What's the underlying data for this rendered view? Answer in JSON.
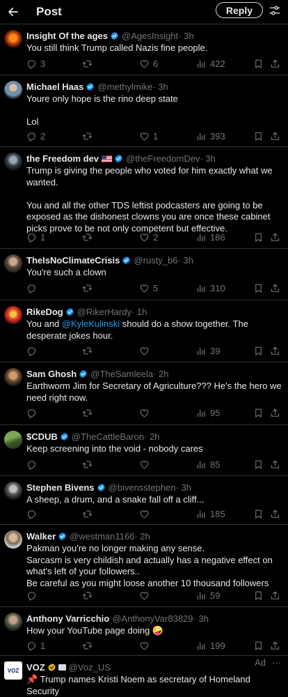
{
  "header": {
    "title": "Post",
    "reply_button": "Reply"
  },
  "colors": {
    "background": "#000000",
    "text": "#e7e9ea",
    "muted": "#71767b",
    "divider": "#2f3336",
    "verified": "#1d9bf0",
    "gold_verified": "#e2b719"
  },
  "replies": [
    {
      "name": "Insight Of the ages",
      "handle": "@AgesInsight",
      "time": "· 3h",
      "text": "You still think Trump called Nazis fine people.",
      "replies": "3",
      "retweets": "",
      "likes": "6",
      "views": "422"
    },
    {
      "name": "Michael Haas",
      "handle": "@methylmike",
      "time": "· 3h",
      "text_lines": [
        "Youre only hope is the rino deep state",
        "",
        "Lol"
      ],
      "replies": "2",
      "retweets": "",
      "likes": "1",
      "views": "393"
    },
    {
      "name": "the Freedom dev",
      "handle": "@theFreedomDev",
      "time": "· 3h",
      "text_lines": [
        "Trump is giving the people who voted for him exactly what we",
        "wanted.",
        "",
        "You and all the other TDS leftist podcasters are going to be",
        "exposed as the dishonest clowns you are once these cabinet",
        "picks prove to be not only competent but effective."
      ],
      "replies": "1",
      "retweets": "",
      "likes": "2",
      "views": "186"
    },
    {
      "name": "TheIsNoClimateCrisis",
      "handle": "@rusty_b6",
      "time": "· 3h",
      "text": "You're such a clown",
      "replies": "",
      "retweets": "",
      "likes": "5",
      "views": "310"
    },
    {
      "name": "RikeDog",
      "handle": "@RikerHardy",
      "time": "· 1h",
      "text_before": "You and ",
      "mention": "@KyleKulinski",
      "text_after": " should do a show together. The",
      "text_line2": "desperate jokes hour.",
      "replies": "",
      "retweets": "",
      "likes": "",
      "views": "39"
    },
    {
      "name": "Sam Ghosh",
      "handle": "@TheSamleela",
      "time": "· 2h",
      "text_lines": [
        "Earthworm Jim for Secretary of Agriculture??? He's the hero we",
        "need right now."
      ],
      "replies": "",
      "retweets": "",
      "likes": "",
      "views": "95"
    },
    {
      "name": "$CDUB",
      "handle": "@TheCattleBaron",
      "time": "· 2h",
      "text": "Keep screening into the void - nobody cares",
      "replies": "",
      "retweets": "",
      "likes": "",
      "views": "85"
    },
    {
      "name": "Stephen Bivens",
      "handle": "@bivensstephen",
      "time": "· 3h",
      "text": "A sheep, a drum, and a snake fall off a cliff...",
      "replies": "",
      "retweets": "",
      "likes": "",
      "views": "185"
    },
    {
      "name": "Walker",
      "handle": "@westman1166",
      "time": "· 2h",
      "text_lines": [
        "Pakman you're no longer making any sense.",
        "Sarcasm is very childish and actually has a negative effect on",
        "what's left of your followers..",
        "Be careful as you might loose another 10 thousand followers"
      ],
      "replies": "",
      "retweets": "",
      "likes": "",
      "views": "59"
    },
    {
      "name": "Anthony Varricchio",
      "handle": "@AnthonyVar83829",
      "time": "· 3h",
      "text": "How your YouTube page doing 🤪",
      "replies": "1",
      "retweets": "",
      "likes": "",
      "views": "199"
    }
  ],
  "ad": {
    "name": "VOZ",
    "handle": "@Voz_US",
    "label": "Ad",
    "more": "···",
    "avatar_text": "VOZ",
    "text_line1": "📌 Trump names Kristi Noem as secretary of Homeland",
    "text_line2": "Security"
  },
  "icons": [
    "back-arrow-icon",
    "filter-icon",
    "verified-badge-icon",
    "reply-icon",
    "retweet-icon",
    "like-icon",
    "views-icon",
    "bookmark-icon",
    "share-icon"
  ]
}
